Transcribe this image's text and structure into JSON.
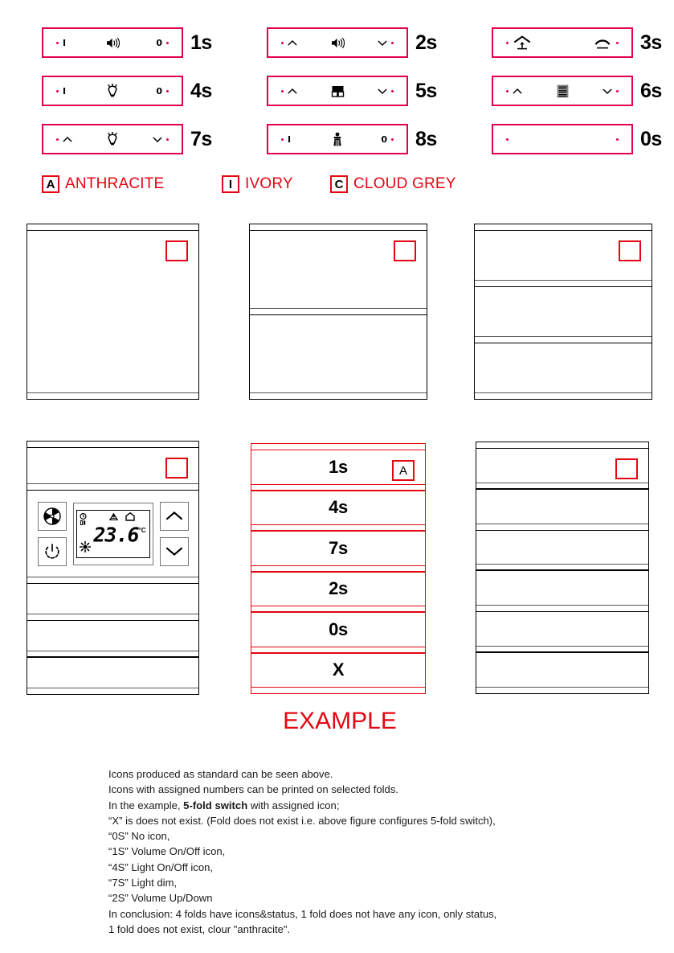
{
  "icon_legend": {
    "rows": [
      {
        "code": "1s",
        "left_state": "I",
        "right_state": "0",
        "center_icon": "speaker-volume-icon",
        "left_led": true,
        "right_led": true,
        "meaning": "Volume On/Off"
      },
      {
        "code": "2s",
        "left_state": "^",
        "right_state": "v",
        "center_icon": "speaker-volume-icon",
        "left_led": true,
        "right_led": true,
        "meaning": "Volume Up/Down"
      },
      {
        "code": "3s",
        "left_state": "",
        "right_state": "",
        "center_icon": "awning-up-down-icon",
        "left_led": true,
        "right_led": true,
        "meaning": "Awning Up/Down"
      },
      {
        "code": "4s",
        "left_state": "I",
        "right_state": "0",
        "center_icon": "lamp-bulb-icon",
        "left_led": true,
        "right_led": true,
        "meaning": "Light On/Off"
      },
      {
        "code": "5s",
        "left_state": "^",
        "right_state": "v",
        "center_icon": "roller-shutter-icon",
        "left_led": true,
        "right_led": true,
        "meaning": "Roller Shutter Up/Down"
      },
      {
        "code": "6s",
        "left_state": "^",
        "right_state": "v",
        "center_icon": "venetian-blind-icon",
        "left_led": true,
        "right_led": true,
        "meaning": "Venetian Blind Up/Down"
      },
      {
        "code": "7s",
        "left_state": "^",
        "right_state": "v",
        "center_icon": "lamp-bulb-icon",
        "left_led": true,
        "right_led": true,
        "meaning": "Light dim"
      },
      {
        "code": "8s",
        "left_state": "I",
        "right_state": "0",
        "center_icon": "bell-figure-icon",
        "left_led": true,
        "right_led": true,
        "meaning": "Bell"
      },
      {
        "code": "0s",
        "left_state": "",
        "right_state": "",
        "center_icon": "",
        "left_led": true,
        "right_led": true,
        "meaning": "No icon"
      }
    ]
  },
  "colour_legend": {
    "items": [
      {
        "code": "A",
        "name": "ANTHRACITE"
      },
      {
        "code": "I",
        "name": "IVORY"
      },
      {
        "code": "C",
        "name": "CLOUD GREY"
      }
    ],
    "code_border_color": "#e30613",
    "name_color": "#e30613"
  },
  "panels": {
    "top_row": [
      {
        "id": "panel-1-fold",
        "folds": 1,
        "status_marker": "",
        "labels": [
          ""
        ]
      },
      {
        "id": "panel-2-fold",
        "folds": 2,
        "status_marker": "",
        "labels": [
          "",
          ""
        ]
      },
      {
        "id": "panel-3-fold",
        "folds": 3,
        "status_marker": "",
        "labels": [
          "",
          "",
          ""
        ]
      }
    ],
    "bottom_row": [
      {
        "id": "panel-thermostat",
        "folds": 4,
        "status_marker": "",
        "labels": [
          "",
          "",
          "",
          ""
        ],
        "thermostat": {
          "fan_button": "fan-icon",
          "power_button": "power-icon",
          "up_button": "chevron-up-icon",
          "down_button": "chevron-down-icon",
          "display_value": "23.6",
          "display_unit": "°C",
          "display_icons": [
            "clock-icon",
            "heating-alert-icon",
            "home-icon",
            "snowflake-sun-icon"
          ]
        }
      },
      {
        "id": "panel-example-5-fold",
        "folds": 6,
        "status_marker": "A",
        "labels": [
          "1s",
          "4s",
          "7s",
          "2s",
          "0s",
          "X"
        ],
        "highlight": true
      },
      {
        "id": "panel-6-fold",
        "folds": 6,
        "status_marker": "",
        "labels": [
          "",
          "",
          "",
          "",
          "",
          ""
        ]
      }
    ]
  },
  "example_caption": "EXAMPLE",
  "notes": {
    "lines": [
      {
        "text": "Icons produced as standard can be seen above."
      },
      {
        "text": "Icons with assigned numbers can be printed on selected folds."
      },
      {
        "pre": "In the example, ",
        "bold": "5-fold switch",
        "post": " with assigned icon;"
      },
      {
        "text": "“X” is does not exist. (Fold does not exist i.e. above figure configures 5-fold switch),"
      },
      {
        "text": "“0S” No icon,"
      },
      {
        "text": "“1S” Volume On/Off icon,"
      },
      {
        "text": "“4S” Light On/Off icon,"
      },
      {
        "text": "“7S” Light dim,"
      },
      {
        "text": "“2S” Volume Up/Down"
      },
      {
        "text": "In conclusion: 4 folds have icons&status, 1 fold does not have any icon, only status,"
      },
      {
        "text": "1 fold does not exist, clour \"anthracite\"."
      }
    ]
  },
  "colors": {
    "magenta_frame": "#e3004f",
    "red": "#e30613",
    "black": "#000000"
  }
}
